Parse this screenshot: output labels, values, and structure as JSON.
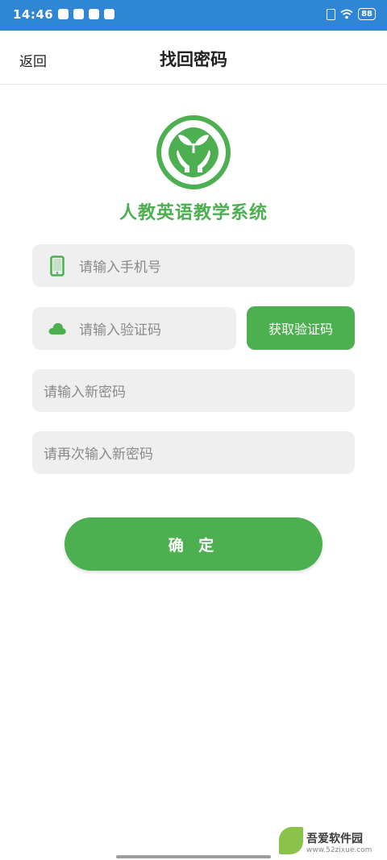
{
  "status_bar": {
    "time": "14:46",
    "battery": "88"
  },
  "header": {
    "back_label": "返回",
    "title": "找回密码"
  },
  "app": {
    "name": "人教英语教学系统",
    "brand_color": "#4caf50"
  },
  "form": {
    "phone_placeholder": "请输入手机号",
    "code_placeholder": "请输入验证码",
    "get_code_label": "获取验证码",
    "new_password_placeholder": "请输入新密码",
    "confirm_password_placeholder": "请再次输入新密码",
    "confirm_label": "确 定"
  },
  "watermark": {
    "main": "吾爱软件园",
    "sub": "www.52zixue.com"
  }
}
